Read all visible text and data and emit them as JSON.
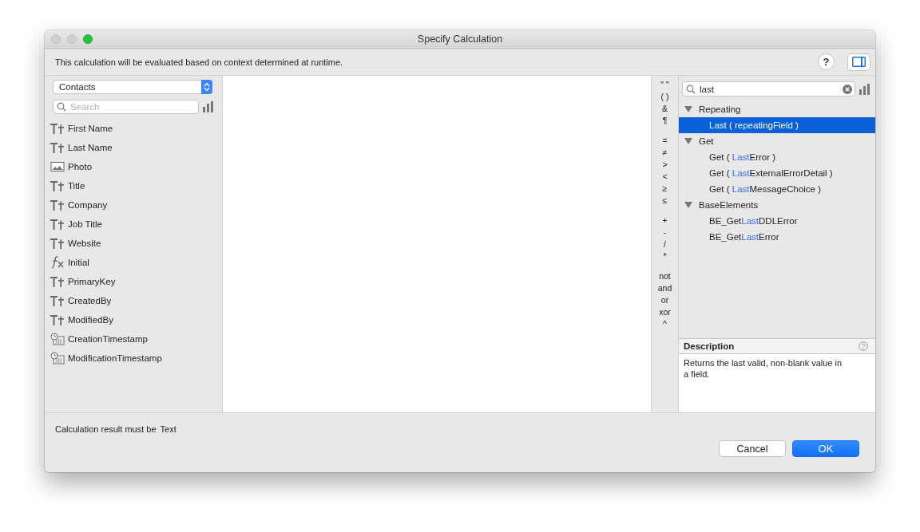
{
  "window": {
    "title": "Specify Calculation"
  },
  "context_note": "This calculation will be evaluated based on context determined at runtime.",
  "help_button": {
    "label": "?"
  },
  "table_popup": {
    "value": "Contacts"
  },
  "field_search": {
    "placeholder": "Search"
  },
  "fields": [
    {
      "name": "First Name",
      "kind": "text"
    },
    {
      "name": "Last Name",
      "kind": "text"
    },
    {
      "name": "Photo",
      "kind": "container"
    },
    {
      "name": "Title",
      "kind": "text"
    },
    {
      "name": "Company",
      "kind": "text"
    },
    {
      "name": "Job Title",
      "kind": "text"
    },
    {
      "name": "Website",
      "kind": "text"
    },
    {
      "name": "Initial",
      "kind": "calculation"
    },
    {
      "name": "PrimaryKey",
      "kind": "text"
    },
    {
      "name": "CreatedBy",
      "kind": "text"
    },
    {
      "name": "ModifiedBy",
      "kind": "text"
    },
    {
      "name": "CreationTimestamp",
      "kind": "timestamp"
    },
    {
      "name": "ModificationTimestamp",
      "kind": "timestamp"
    }
  ],
  "operators": [
    {
      "items": [
        "\" \"",
        "( )",
        "&",
        "¶"
      ]
    },
    {
      "items": [
        "=",
        "≠",
        ">",
        "<",
        "≥",
        "≤"
      ]
    },
    {
      "items": [
        "+",
        "-",
        "/",
        "*"
      ]
    },
    {
      "items": [
        "not",
        "and",
        "or",
        "xor",
        "^"
      ]
    }
  ],
  "function_search": {
    "value": "last"
  },
  "functions": [
    {
      "label": "Repeating",
      "expanded": true,
      "selected": false,
      "children": [
        {
          "match": "Last",
          "after": " ( repeatingField )",
          "selected": true
        }
      ]
    },
    {
      "label": "Get",
      "expanded": true,
      "selected": false,
      "children": [
        {
          "before": "Get ( ",
          "match": "Last",
          "after": "Error )",
          "selected": false
        },
        {
          "before": "Get ( ",
          "match": "Last",
          "after": "ExternalErrorDetail )",
          "selected": false
        },
        {
          "before": "Get ( ",
          "match": "Last",
          "after": "MessageChoice )",
          "selected": false
        }
      ]
    },
    {
      "label": "BaseElements",
      "expanded": true,
      "selected": false,
      "children": [
        {
          "before": "BE_Get",
          "match": "Last",
          "after": "DDLError",
          "selected": false
        },
        {
          "before": "BE_Get",
          "match": "Last",
          "after": "Error",
          "selected": false
        }
      ]
    }
  ],
  "description": {
    "title": "Description",
    "text": "Returns the last valid, non-blank value in a field."
  },
  "result_type": {
    "label": "Calculation result must be",
    "value": "Text"
  },
  "buttons": [
    {
      "label": "Cancel",
      "kind": "normal"
    },
    {
      "label": "OK",
      "kind": "default"
    }
  ]
}
